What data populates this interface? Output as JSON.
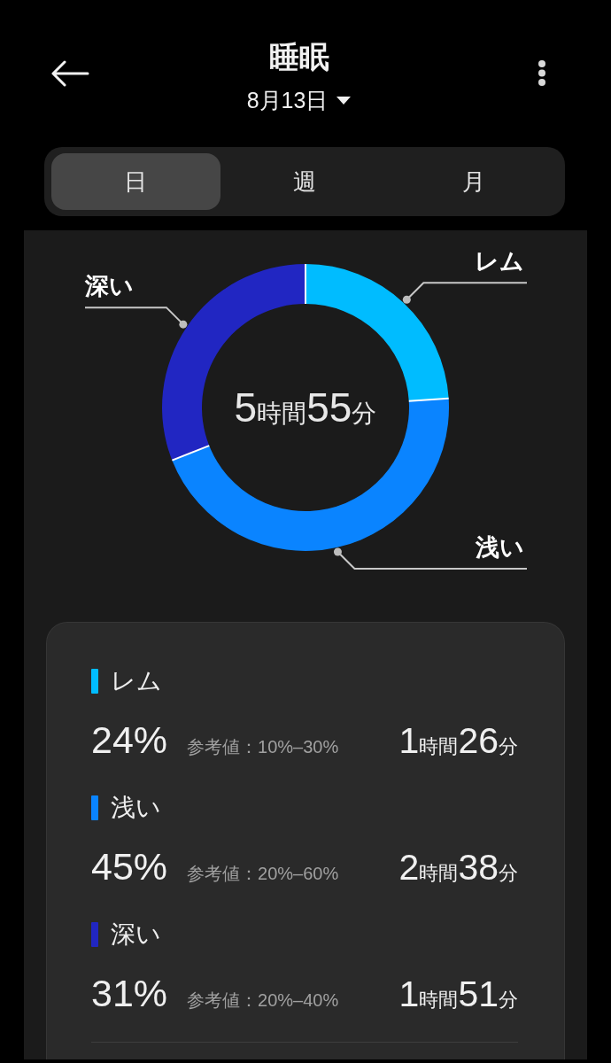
{
  "header": {
    "title": "睡眠",
    "date": "8月13日"
  },
  "tabs": [
    {
      "label": "日",
      "selected": true
    },
    {
      "label": "週",
      "selected": false
    },
    {
      "label": "月",
      "selected": false
    }
  ],
  "sleep_chart": {
    "total": "5時間55分",
    "chart_data": {
      "type": "donut",
      "categories": [
        "レム",
        "浅い",
        "深い"
      ],
      "values": [
        24,
        45,
        31
      ]
    }
  },
  "stages": [
    {
      "name": "レム",
      "color": "#00bcff",
      "percent": "24%",
      "reference": "参考値：10%–30%",
      "duration": "1時間26分"
    },
    {
      "name": "浅い",
      "color": "#0a84ff",
      "percent": "45%",
      "reference": "参考値：20%–60%",
      "duration": "2時間38分"
    },
    {
      "name": "深い",
      "color": "#2126c2",
      "percent": "31%",
      "reference": "参考値：20%–40%",
      "duration": "1時間51分"
    }
  ]
}
